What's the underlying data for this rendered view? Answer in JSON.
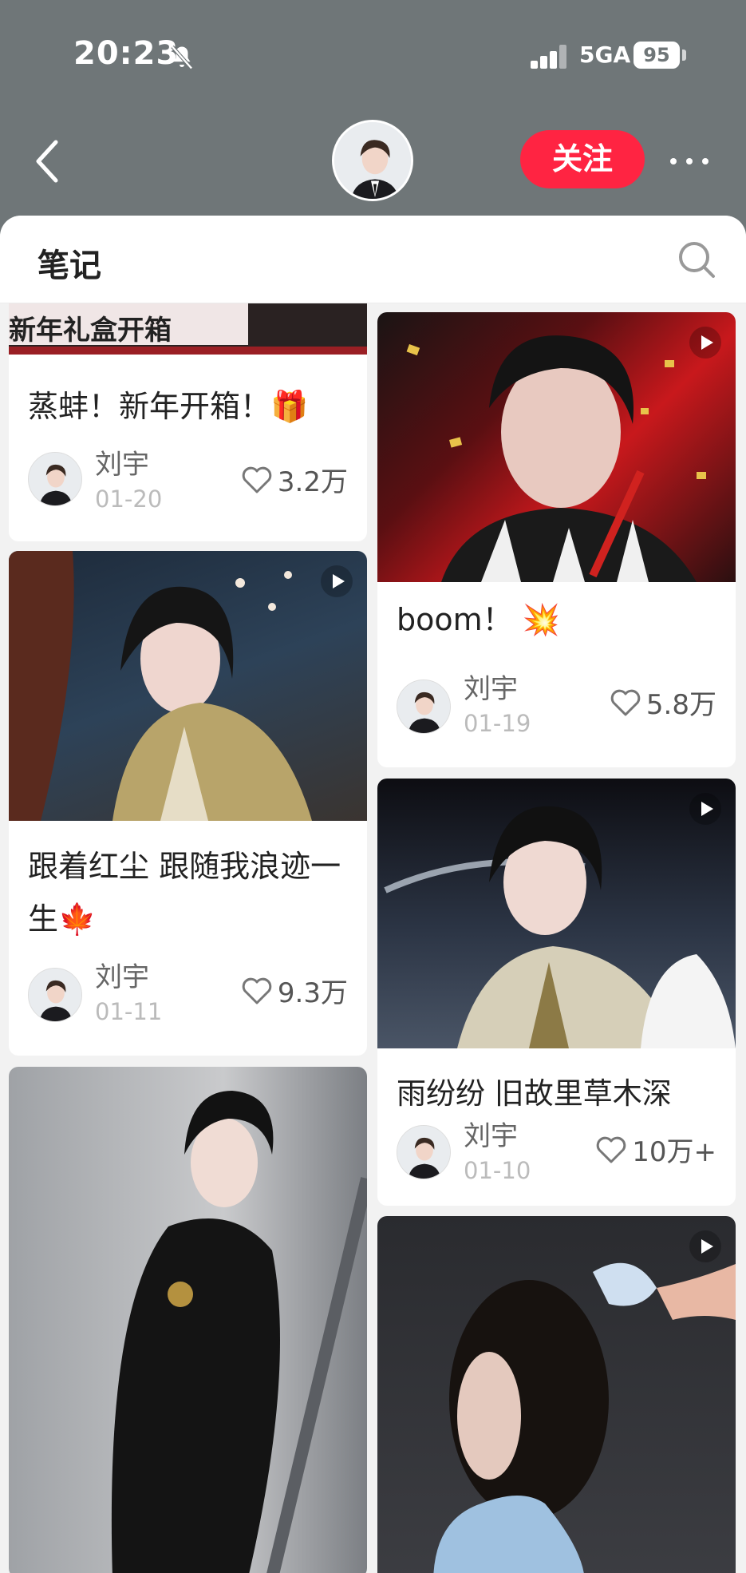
{
  "status_bar": {
    "time": "20:23",
    "network": "5GA",
    "battery": "95"
  },
  "header": {
    "follow_label": "关注"
  },
  "sheet": {
    "title": "笔记"
  },
  "notes": [
    {
      "title": "蒸蚌！新年开箱！🎁",
      "banner_text": "新年礼盒开箱",
      "author": "刘宇",
      "date": "01-20",
      "likes": "3.2万",
      "is_video": false
    },
    {
      "title": "boom！ 💥",
      "author": "刘宇",
      "date": "01-19",
      "likes": "5.8万",
      "is_video": true
    },
    {
      "title": "跟着红尘 跟随我浪迹一生🍁",
      "author": "刘宇",
      "date": "01-11",
      "likes": "9.3万",
      "is_video": true
    },
    {
      "title": "雨纷纷 旧故里草木深",
      "author": "刘宇",
      "date": "01-10",
      "likes": "10万+",
      "is_video": true
    },
    {
      "title": "",
      "author": "",
      "date": "",
      "likes": "",
      "is_video": false
    },
    {
      "title": "",
      "author": "",
      "date": "",
      "likes": "",
      "is_video": true
    }
  ],
  "colors": {
    "accent": "#ff2442",
    "header_bg": "#6f7678"
  }
}
